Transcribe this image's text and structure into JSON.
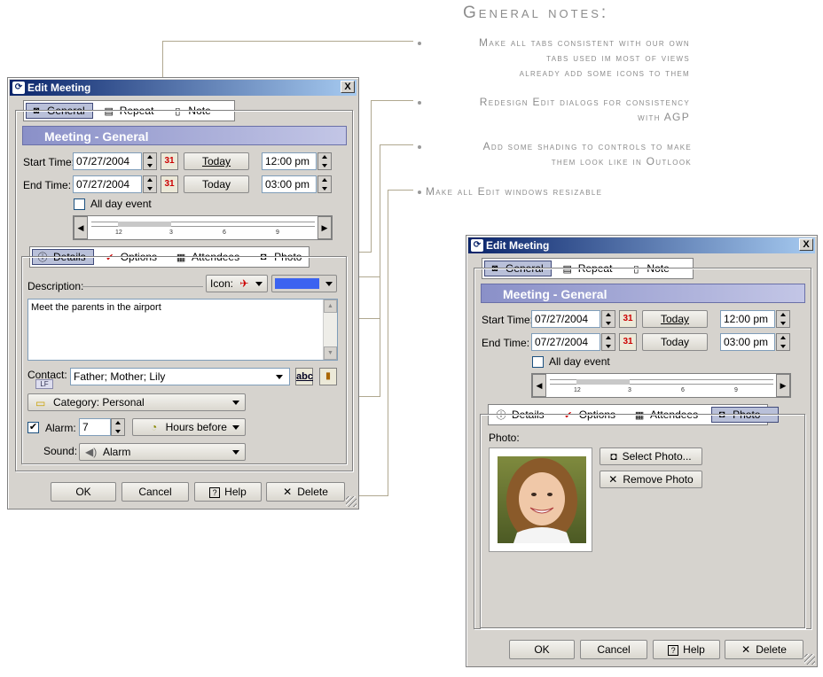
{
  "notes": {
    "title": "General notes:",
    "items": [
      "Make all tabs consistent with our own tabs used im most of views already add some icons to them",
      "Redesign Edit dialogs for consistency with AGP",
      "Add some shading to controls to make them look like in Outlook",
      "Make all Edit windows resizable"
    ],
    "lines": [
      [
        "Make all tabs consistent with our own",
        "tabs used im most of views",
        "already add some icons to them"
      ],
      [
        "Redesign Edit dialogs for consistency",
        "with AGP"
      ],
      [
        "Add some shading to controls to make",
        "them look like in Outlook"
      ],
      [
        "Make all Edit windows resizable"
      ]
    ]
  },
  "dialog": {
    "title": "Edit Meeting",
    "close": "X",
    "tabs": [
      "General",
      "Repeat",
      "Note"
    ],
    "section_header": "Meeting - General",
    "start_label": "Start Time:",
    "end_label": "End Time:",
    "start_date": "07/27/2004",
    "end_date": "07/27/2004",
    "start_time": "12:00 pm",
    "end_time": "03:00 pm",
    "today_label": "Today",
    "all_day_label": "All day event",
    "timeline_ticks": [
      "12",
      "3",
      "6",
      "9"
    ],
    "buttons": {
      "ok": "OK",
      "cancel": "Cancel",
      "help": "Help",
      "delete": "Delete"
    }
  },
  "left": {
    "subtabs": [
      "Details",
      "Options",
      "Attendees",
      "Photo"
    ],
    "description_label": "Description:",
    "icon_label": "Icon:",
    "description_text": "Meet the parents in the airport",
    "contact_label": "Contact:",
    "contact_badge": "LF",
    "contact_value": "Father; Mother; Lily",
    "spell_label": "abc",
    "category": "Category: Personal",
    "alarm_label": "Alarm:",
    "alarm_value": "7",
    "alarm_unit": "Hours before",
    "sound_label": "Sound:",
    "sound_value": "Alarm",
    "color_swatch": "#3b63f0"
  },
  "right": {
    "subtabs": [
      "Details",
      "Options",
      "Attendees",
      "Photo"
    ],
    "photo_label": "Photo:",
    "select_photo": "Select Photo...",
    "remove_photo": "Remove Photo"
  }
}
